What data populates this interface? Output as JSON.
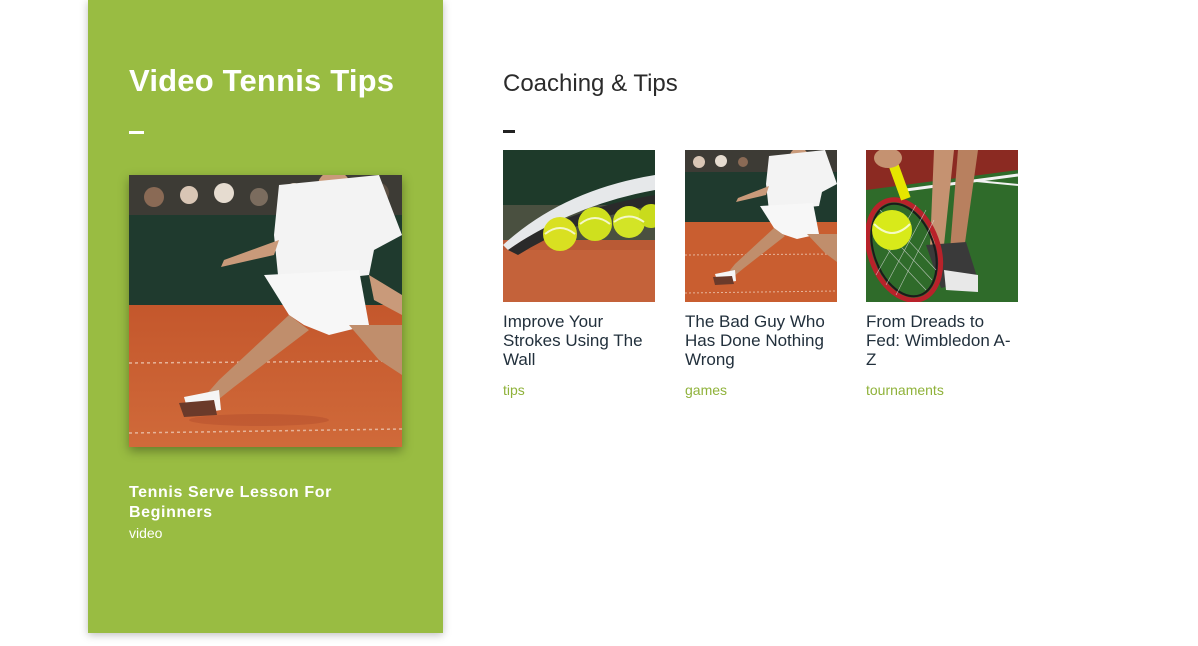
{
  "colors": {
    "panel_green": "#99bc42",
    "tag_green": "#8fb23a",
    "heading_dark": "#2b2b2b",
    "card_title": "#22303c"
  },
  "feature": {
    "title": "Video Tennis Tips",
    "image_alt": "tennis-player-on-clay-court",
    "caption": "Tennis Serve Lesson For Beginners",
    "tag": "video"
  },
  "section": {
    "title": "Coaching & Tips"
  },
  "cards": [
    {
      "title": "Improve Your Strokes Using The Wall",
      "tag": "tips",
      "image": "tennis-balls-and-racket-on-clay"
    },
    {
      "title": "The Bad Guy Who Has Done Nothing Wrong",
      "tag": "games",
      "image": "tennis-player-on-clay-court"
    },
    {
      "title": "From Dreads to Fed: Wimbledon A-Z",
      "tag": "tournaments",
      "image": "racket-hitting-ball-on-grass"
    }
  ]
}
